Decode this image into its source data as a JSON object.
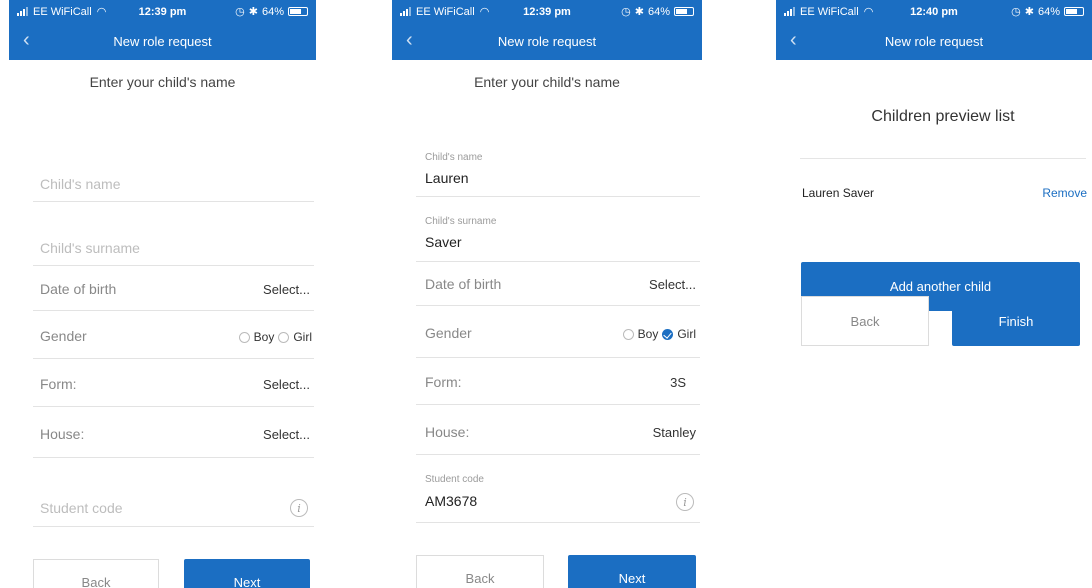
{
  "status_bars": [
    {
      "carrier": "EE WiFiCall",
      "time": "12:39 pm",
      "battery": "64%"
    },
    {
      "carrier": "EE WiFiCall",
      "time": "12:39 pm",
      "battery": "64%"
    },
    {
      "carrier": "EE WiFiCall",
      "time": "12:40 pm",
      "battery": "64%"
    }
  ],
  "nav": {
    "title": "New role request",
    "back_icon": "chevron-left-icon"
  },
  "screen1": {
    "subtitle": "Enter your child's name",
    "child_name_placeholder": "Child's name",
    "child_surname_placeholder": "Child's surname",
    "dob_label": "Date of birth",
    "dob_value": "Select...",
    "gender_label": "Gender",
    "gender_boy": "Boy",
    "gender_girl": "Girl",
    "form_label": "Form:",
    "form_value": "Select...",
    "house_label": "House:",
    "house_value": "Select...",
    "student_code_placeholder": "Student code",
    "back_label": "Back",
    "next_label": "Next"
  },
  "screen2": {
    "subtitle": "Enter your child's name",
    "child_name_caption": "Child's name",
    "child_name_value": "Lauren",
    "child_surname_caption": "Child's surname",
    "child_surname_value": "Saver",
    "dob_label": "Date of birth",
    "dob_value": "Select...",
    "gender_label": "Gender",
    "gender_boy": "Boy",
    "gender_girl": "Girl",
    "gender_selected": "Girl",
    "form_label": "Form:",
    "form_value": "3S",
    "house_label": "House:",
    "house_value": "Stanley",
    "student_code_caption": "Student code",
    "student_code_value": "AM3678",
    "back_label": "Back",
    "next_label": "Next"
  },
  "screen3": {
    "title": "Children preview list",
    "children": [
      {
        "name": "Lauren Saver",
        "action": "Remove"
      }
    ],
    "add_label": "Add another child",
    "back_label": "Back",
    "finish_label": "Finish"
  },
  "colors": {
    "brand": "#1b6ec2"
  }
}
